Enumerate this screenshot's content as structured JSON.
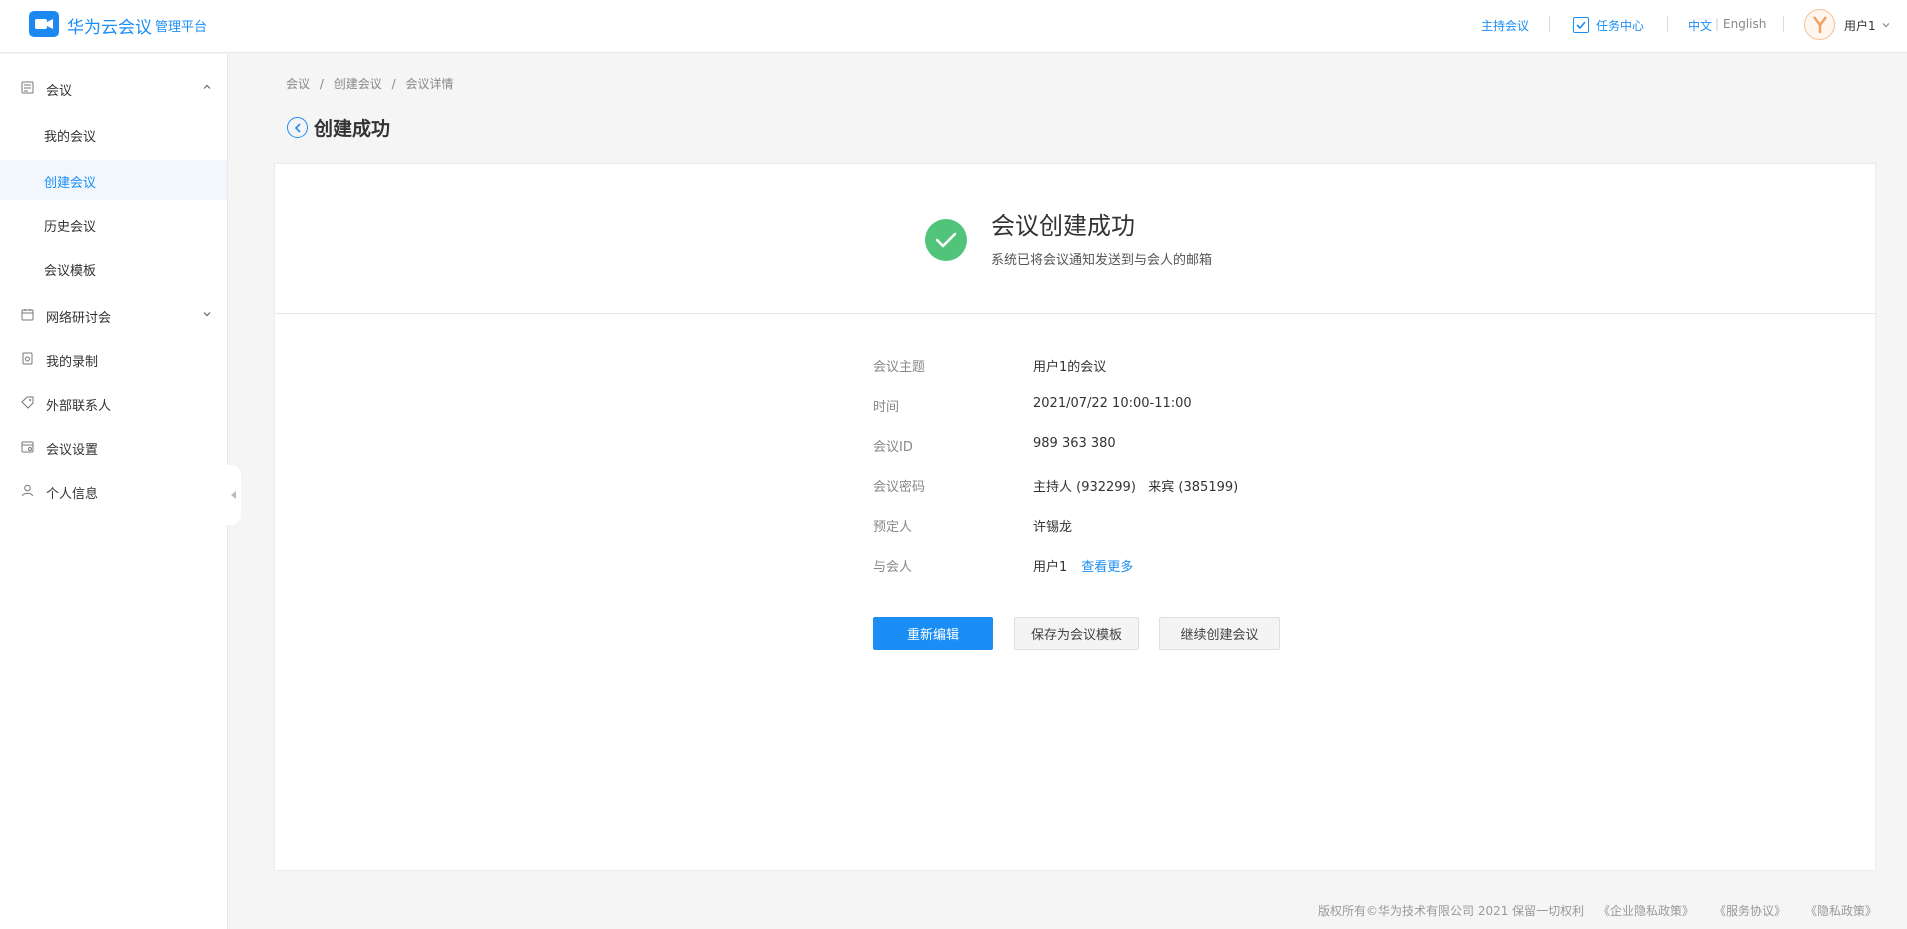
{
  "header": {
    "brand_name": "华为云会议",
    "brand_sub": "管理平台",
    "host_meeting": "主持会议",
    "task_center": "任务中心",
    "lang_zh": "中文",
    "lang_en": "English",
    "user_name": "用户1"
  },
  "sidebar": {
    "meeting_group": "会议",
    "items": [
      "我的会议",
      "创建会议",
      "历史会议",
      "会议模板"
    ],
    "webinar": "网络研讨会",
    "my_recordings": "我的录制",
    "external_contacts": "外部联系人",
    "meeting_settings": "会议设置",
    "personal_info": "个人信息"
  },
  "breadcrumb": [
    "会议",
    "/",
    "创建会议",
    "/",
    "会议详情"
  ],
  "page_title": "创建成功",
  "success": {
    "title": "会议创建成功",
    "subtitle": "系统已将会议通知发送到与会人的邮箱"
  },
  "details": {
    "subject_label": "会议主题",
    "subject_value": "用户1的会议",
    "time_label": "时间",
    "time_value": "2021/07/22 10:00-11:00",
    "id_label": "会议ID",
    "id_value": "989 363 380",
    "password_label": "会议密码",
    "password_value": "主持人 (932299)   来宾 (385199)",
    "booker_label": "预定人",
    "booker_value": "许锡龙",
    "attendees_label": "与会人",
    "attendees_value": "用户1",
    "view_more": "查看更多"
  },
  "actions": {
    "reedit": "重新编辑",
    "save_template": "保存为会议模板",
    "continue_create": "继续创建会议"
  },
  "footer": {
    "copyright": "版权所有©华为技术有限公司 2021 保留一切权利",
    "enterprise_privacy": "《企业隐私政策》",
    "service_agreement": "《服务协议》",
    "privacy_policy": "《隐私政策》"
  },
  "colors": {
    "accent": "#1a8ef5",
    "success": "#52c47a"
  }
}
